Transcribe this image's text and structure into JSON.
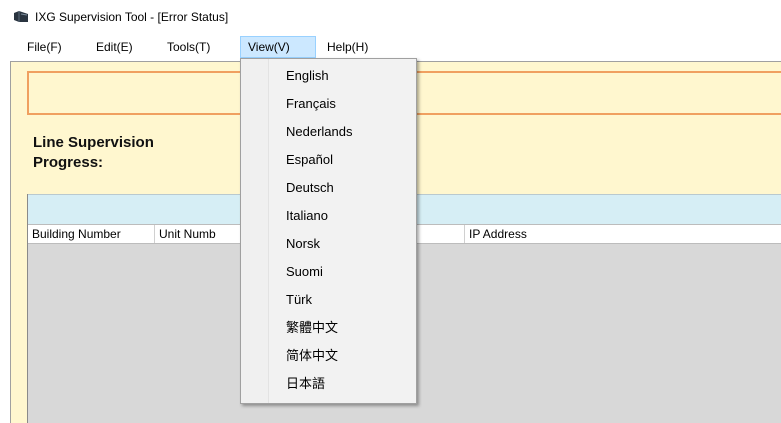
{
  "window": {
    "title": "IXG Supervision Tool - [Error Status]",
    "app_icon": "ixg-app-icon"
  },
  "menubar": {
    "items": [
      {
        "label": "File(F)"
      },
      {
        "label": "Edit(E)"
      },
      {
        "label": "Tools(T)"
      },
      {
        "label": "View(V)",
        "active": true
      },
      {
        "label": "Help(H)"
      }
    ]
  },
  "main": {
    "progress_label_line1": "Line Supervision",
    "progress_label_line2": "Progress:",
    "table": {
      "columns": [
        "Building Number",
        "Unit Numb",
        "IP Address"
      ]
    }
  },
  "view_menu": {
    "items": [
      {
        "label": "English"
      },
      {
        "label": "Français"
      },
      {
        "label": "Nederlands"
      },
      {
        "label": "Español"
      },
      {
        "label": "Deutsch"
      },
      {
        "label": "Italiano"
      },
      {
        "label": "Norsk"
      },
      {
        "label": "Suomi"
      },
      {
        "label": "Türk"
      },
      {
        "label": "繁體中文"
      },
      {
        "label": "简体中文"
      },
      {
        "label": "日本語"
      }
    ]
  },
  "colors": {
    "client_background": "#fff7cf",
    "orange_border": "#f0a060",
    "menu_active": "#cce8ff",
    "table_bluebar": "#d6eef5",
    "table_body": "#d8d8d8"
  }
}
